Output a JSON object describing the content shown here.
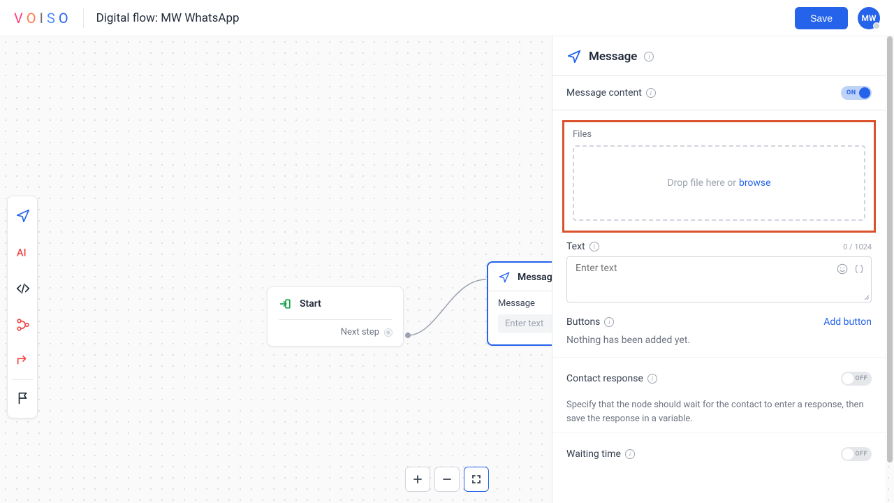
{
  "header": {
    "title_prefix": "Digital flow:",
    "title_name": "MW WhatsApp",
    "save_label": "Save",
    "avatar_initials": "MW"
  },
  "canvas": {
    "start_node": {
      "label": "Start",
      "next_label": "Next step"
    },
    "message_node": {
      "title": "Message",
      "body_label": "Message",
      "placeholder": "Enter text"
    }
  },
  "panel": {
    "title": "Message",
    "content_label": "Message content",
    "content_toggle": "ON",
    "files_label": "Files",
    "dropzone_text": "Drop file here or",
    "browse_label": "browse",
    "text_label": "Text",
    "text_counter": "0 / 1024",
    "text_placeholder": "Enter text",
    "buttons_label": "Buttons",
    "add_button_label": "Add button",
    "buttons_empty": "Nothing has been added yet.",
    "contact_label": "Contact response",
    "contact_toggle": "OFF",
    "contact_desc": "Specify that the node should wait for the contact to enter a response, then save the response in a variable.",
    "waiting_label": "Waiting time",
    "waiting_toggle": "OFF"
  }
}
